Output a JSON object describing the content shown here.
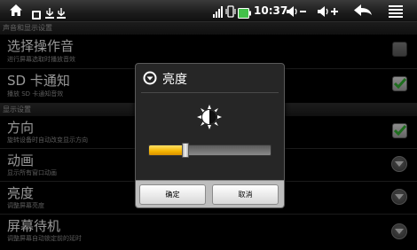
{
  "status_bar": {
    "time": "10:37",
    "icons": [
      "home-icon",
      "app-icon",
      "usb-debug-icon",
      "usb-icon",
      "wifi-icon",
      "vibrate-icon",
      "battery-icon",
      "volume-down-icon",
      "volume-up-icon",
      "back-icon",
      "menu-icon"
    ],
    "battery_color": "#43c04a"
  },
  "sections": [
    {
      "header": "声音和显示设置"
    },
    {
      "header": "显示设置"
    }
  ],
  "items": [
    {
      "title": "选择操作音",
      "summary": "进行屏幕选取时播放音效",
      "control": "checkbox",
      "checked": false
    },
    {
      "title": "SD 卡通知",
      "summary": "播放 SD 卡通知音效",
      "control": "checkbox",
      "checked": true
    },
    {
      "title": "方向",
      "summary": "旋转设备时自动改变显示方向",
      "control": "checkbox",
      "checked": true
    },
    {
      "title": "动画",
      "summary": "显示所有窗口动画",
      "control": "list"
    },
    {
      "title": "亮度",
      "summary": "调整屏幕亮度",
      "control": "list"
    },
    {
      "title": "屏幕待机",
      "summary": "调整屏幕自动锁定前的延时",
      "control": "list"
    }
  ],
  "dialog": {
    "title": "亮度",
    "brightness_level": 0.3,
    "ok_label": "确定",
    "cancel_label": "取消",
    "accent": "#f4b400"
  }
}
